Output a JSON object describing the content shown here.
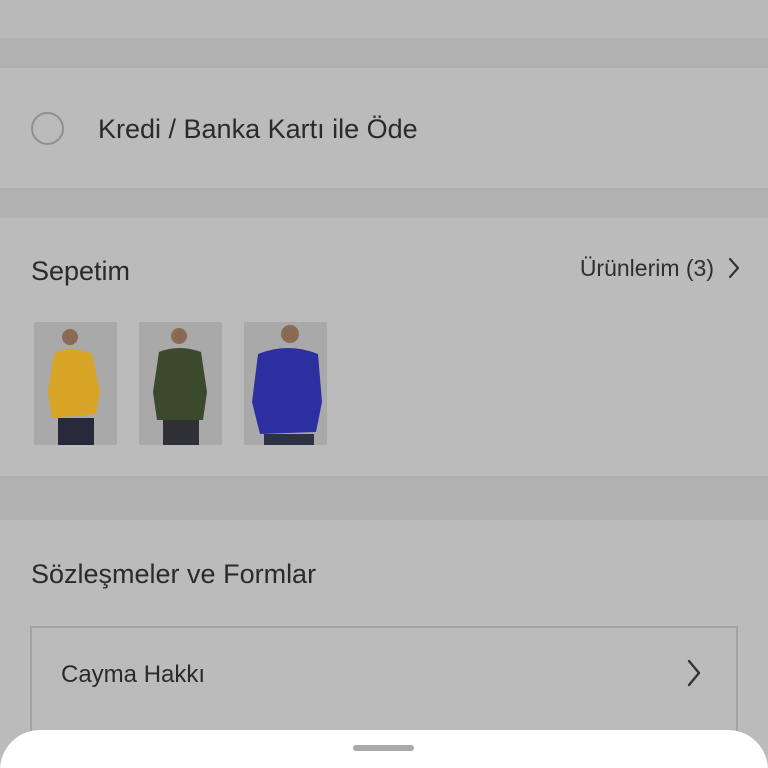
{
  "payment": {
    "option_label": "Kredi / Banka Kartı ile Öde",
    "selected": false
  },
  "cart": {
    "title": "Sepetim",
    "products_link_label": "Ürünlerim (3)",
    "items": [
      {
        "icon": "product-thumbnail-yellow-sweater",
        "color": "#d9a526"
      },
      {
        "icon": "product-thumbnail-green-sweater",
        "color": "#3b4a2d"
      },
      {
        "icon": "product-thumbnail-blue-sweater",
        "color": "#2c2fa0"
      }
    ]
  },
  "forms": {
    "title": "Sözleşmeler ve Formlar",
    "rows": [
      {
        "label": "Cayma Hakkı"
      }
    ]
  },
  "colors": {
    "overlay": "#b9b9b9",
    "sheet": "#ffffff"
  }
}
